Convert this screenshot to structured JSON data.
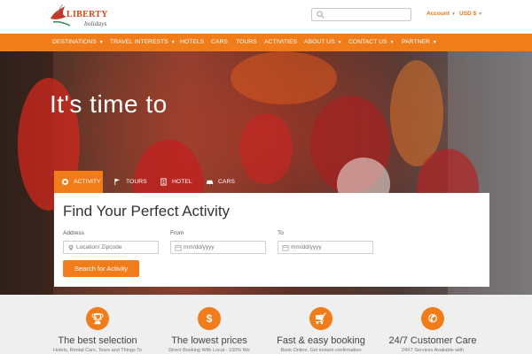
{
  "header": {
    "logo_text": "LIBERTY",
    "logo_sub": "holidays",
    "search_placeholder": "",
    "account_label": "Account",
    "currency_label": "USD $"
  },
  "nav": {
    "items": [
      {
        "label": "DESTINATIONS",
        "has_dropdown": true
      },
      {
        "label": "TRAVEL INTERESTS",
        "has_dropdown": true
      },
      {
        "label": "HOTELS",
        "has_dropdown": false
      },
      {
        "label": "CARS",
        "has_dropdown": false
      },
      {
        "label": "TOURS",
        "has_dropdown": false
      },
      {
        "label": "ACTIVITIES",
        "has_dropdown": false
      },
      {
        "label": "ABOUT US",
        "has_dropdown": true
      },
      {
        "label": "CONTACT US",
        "has_dropdown": true
      },
      {
        "label": "PARTNER",
        "has_dropdown": true
      }
    ]
  },
  "hero": {
    "title": "It's time to"
  },
  "tabs": [
    {
      "label": "ACTIVITY",
      "icon": "activity-icon",
      "active": true
    },
    {
      "label": "TOURS",
      "icon": "flag-icon",
      "active": false
    },
    {
      "label": "HOTEL",
      "icon": "building-icon",
      "active": false
    },
    {
      "label": "CARS",
      "icon": "car-icon",
      "active": false
    }
  ],
  "search_panel": {
    "title": "Find Your Perfect Activity",
    "address_label": "Address",
    "address_placeholder": "Location/ Zipcode",
    "from_label": "From",
    "from_placeholder": "mm/dd/yyyy",
    "to_label": "To",
    "to_placeholder": "mm/dd/yyyy",
    "button_label": "Search for Activity"
  },
  "features": [
    {
      "icon": "trophy-icon",
      "title": "The best selection",
      "subtitle": "Hotels, Rental Cars, Tours and Things To"
    },
    {
      "icon": "dollar-icon",
      "title": "The lowest prices",
      "subtitle": "Direct Booking With Local - 100% We"
    },
    {
      "icon": "cart-icon",
      "title": "Fast & easy booking",
      "subtitle": "Book Online, Get instant confirmation"
    },
    {
      "icon": "phone-icon",
      "title": "24/7 Customer Care",
      "subtitle": "24X7 Services Available with"
    }
  ],
  "colors": {
    "accent": "#f07c1a",
    "panel_bg": "#ffffff",
    "features_bg": "#efefef"
  }
}
